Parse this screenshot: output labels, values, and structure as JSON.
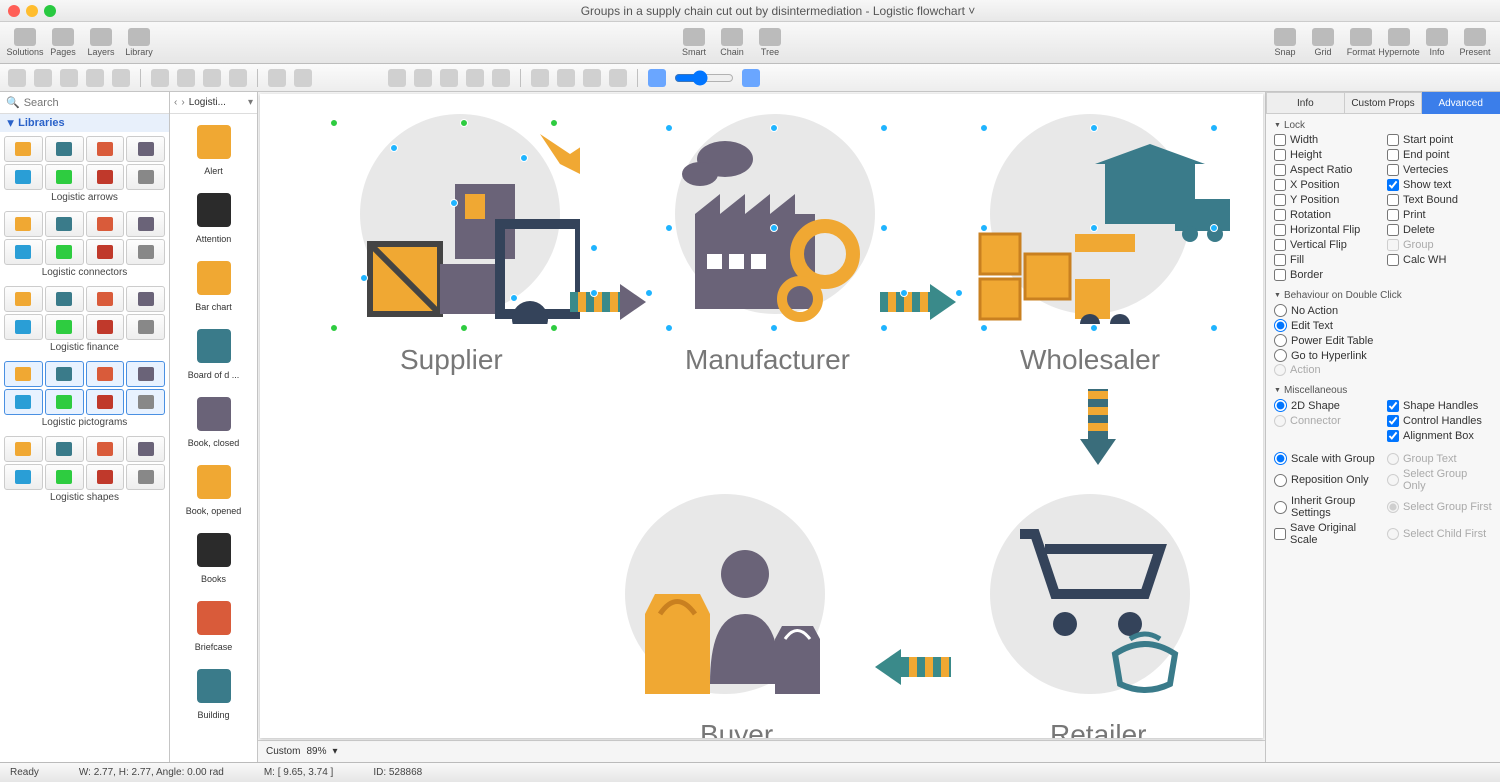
{
  "window": {
    "title": "Groups in a supply chain cut out by disintermediation - Logistic flowchart ˅"
  },
  "toolbar": {
    "left": [
      {
        "id": "solutions",
        "label": "Solutions"
      },
      {
        "id": "pages",
        "label": "Pages"
      },
      {
        "id": "layers",
        "label": "Layers"
      },
      {
        "id": "library",
        "label": "Library"
      }
    ],
    "center": [
      {
        "id": "smart",
        "label": "Smart"
      },
      {
        "id": "chain",
        "label": "Chain"
      },
      {
        "id": "tree",
        "label": "Tree"
      }
    ],
    "right": [
      {
        "id": "snap",
        "label": "Snap"
      },
      {
        "id": "grid",
        "label": "Grid"
      },
      {
        "id": "format",
        "label": "Format"
      },
      {
        "id": "hypernote",
        "label": "Hypernote"
      },
      {
        "id": "info",
        "label": "Info"
      },
      {
        "id": "present",
        "label": "Present"
      }
    ]
  },
  "search": {
    "placeholder": "Search"
  },
  "libraries": {
    "header": "Libraries",
    "categories": [
      {
        "id": "logistic-arrows",
        "label": "Logistic arrows",
        "rows": 2,
        "selected": false
      },
      {
        "id": "logistic-connectors",
        "label": "Logistic connectors",
        "rows": 2,
        "selected": false
      },
      {
        "id": "logistic-finance",
        "label": "Logistic finance",
        "rows": 2,
        "selected": false
      },
      {
        "id": "logistic-pictograms",
        "label": "Logistic pictograms",
        "rows": 2,
        "selected": true
      },
      {
        "id": "logistic-shapes",
        "label": "Logistic shapes",
        "rows": 2,
        "selected": false
      }
    ]
  },
  "shapecol": {
    "crumb": "Logisti...",
    "items": [
      {
        "id": "alert",
        "label": "Alert",
        "color": "#f0a833"
      },
      {
        "id": "attention",
        "label": "Attention",
        "color": "#2b2b2b"
      },
      {
        "id": "bar-chart",
        "label": "Bar chart",
        "color": "#f0a833"
      },
      {
        "id": "board-of-d",
        "label": "Board of d ...",
        "color": "#3a7b8a"
      },
      {
        "id": "book-closed",
        "label": "Book, closed",
        "color": "#6a6378"
      },
      {
        "id": "book-opened",
        "label": "Book, opened",
        "color": "#f0a833"
      },
      {
        "id": "books",
        "label": "Books",
        "color": "#2b2b2b"
      },
      {
        "id": "briefcase",
        "label": "Briefcase",
        "color": "#d95b3a"
      },
      {
        "id": "building",
        "label": "Building",
        "color": "#3a7b8a"
      }
    ]
  },
  "canvas": {
    "nodes": [
      {
        "id": "supplier",
        "label": "Supplier"
      },
      {
        "id": "manufacturer",
        "label": "Manufacturer"
      },
      {
        "id": "wholesaler",
        "label": "Wholesaler"
      },
      {
        "id": "retailer",
        "label": "Retailer"
      },
      {
        "id": "buyer",
        "label": "Buyer"
      }
    ]
  },
  "zoom": {
    "mode": "Custom",
    "percent": "89%"
  },
  "inspector": {
    "tabs": [
      "Info",
      "Custom Props",
      "Advanced"
    ],
    "active": "Advanced",
    "sections": {
      "lock": {
        "title": "Lock",
        "left": [
          {
            "id": "width",
            "label": "Width",
            "checked": false
          },
          {
            "id": "height",
            "label": "Height",
            "checked": false
          },
          {
            "id": "aspect",
            "label": "Aspect Ratio",
            "checked": false
          },
          {
            "id": "xpos",
            "label": "X Position",
            "checked": false
          },
          {
            "id": "ypos",
            "label": "Y Position",
            "checked": false
          },
          {
            "id": "rotation",
            "label": "Rotation",
            "checked": false
          },
          {
            "id": "hflip",
            "label": "Horizontal Flip",
            "checked": false
          },
          {
            "id": "vflip",
            "label": "Vertical Flip",
            "checked": false
          },
          {
            "id": "fill",
            "label": "Fill",
            "checked": false
          },
          {
            "id": "border",
            "label": "Border",
            "checked": false
          }
        ],
        "right": [
          {
            "id": "startpoint",
            "label": "Start point",
            "checked": false
          },
          {
            "id": "endpoint",
            "label": "End point",
            "checked": false
          },
          {
            "id": "vertecies",
            "label": "Vertecies",
            "checked": false
          },
          {
            "id": "showtext",
            "label": "Show text",
            "checked": true
          },
          {
            "id": "textbound",
            "label": "Text Bound",
            "checked": false
          },
          {
            "id": "print",
            "label": "Print",
            "checked": false
          },
          {
            "id": "delete",
            "label": "Delete",
            "checked": false
          },
          {
            "id": "group",
            "label": "Group",
            "checked": false,
            "disabled": true
          },
          {
            "id": "calcwh",
            "label": "Calc WH",
            "checked": false
          }
        ]
      },
      "behaviour": {
        "title": "Behaviour on Double Click",
        "options": [
          {
            "id": "noaction",
            "label": "No Action"
          },
          {
            "id": "edittext",
            "label": "Edit Text"
          },
          {
            "id": "poweredit",
            "label": "Power Edit Table"
          },
          {
            "id": "hyperlink",
            "label": "Go to Hyperlink"
          },
          {
            "id": "action",
            "label": "Action",
            "disabled": true
          }
        ],
        "selected": "edittext"
      },
      "misc": {
        "title": "Miscellaneous",
        "shape": {
          "options": [
            {
              "id": "2d",
              "label": "2D Shape"
            },
            {
              "id": "connector",
              "label": "Connector",
              "disabled": true
            }
          ],
          "selected": "2d"
        },
        "handles": [
          {
            "id": "shapeh",
            "label": "Shape Handles",
            "checked": true
          },
          {
            "id": "controlh",
            "label": "Control Handles",
            "checked": true
          },
          {
            "id": "alignbox",
            "label": "Alignment Box",
            "checked": true
          }
        ],
        "scale": {
          "options": [
            {
              "id": "scalegroup",
              "label": "Scale with Group"
            },
            {
              "id": "reposition",
              "label": "Reposition Only"
            },
            {
              "id": "inherit",
              "label": "Inherit Group Settings"
            }
          ],
          "selected": "scalegroup",
          "save": {
            "id": "saveorig",
            "label": "Save Original Scale",
            "checked": false
          }
        },
        "selectopts": [
          {
            "id": "grouptext",
            "label": "Group Text",
            "disabled": true
          },
          {
            "id": "selgrouponly",
            "label": "Select Group Only",
            "disabled": true
          },
          {
            "id": "selgroupfirst",
            "label": "Select Group First",
            "disabled": true,
            "checked": true
          },
          {
            "id": "selchildfirst",
            "label": "Select Child First",
            "disabled": true
          }
        ]
      }
    }
  },
  "statusbar": {
    "ready": "Ready",
    "dims": "W: 2.77,  H: 2.77,  Angle: 0.00 rad",
    "mouse": "M: [ 9.65, 3.74 ]",
    "id": "ID: 528868"
  }
}
